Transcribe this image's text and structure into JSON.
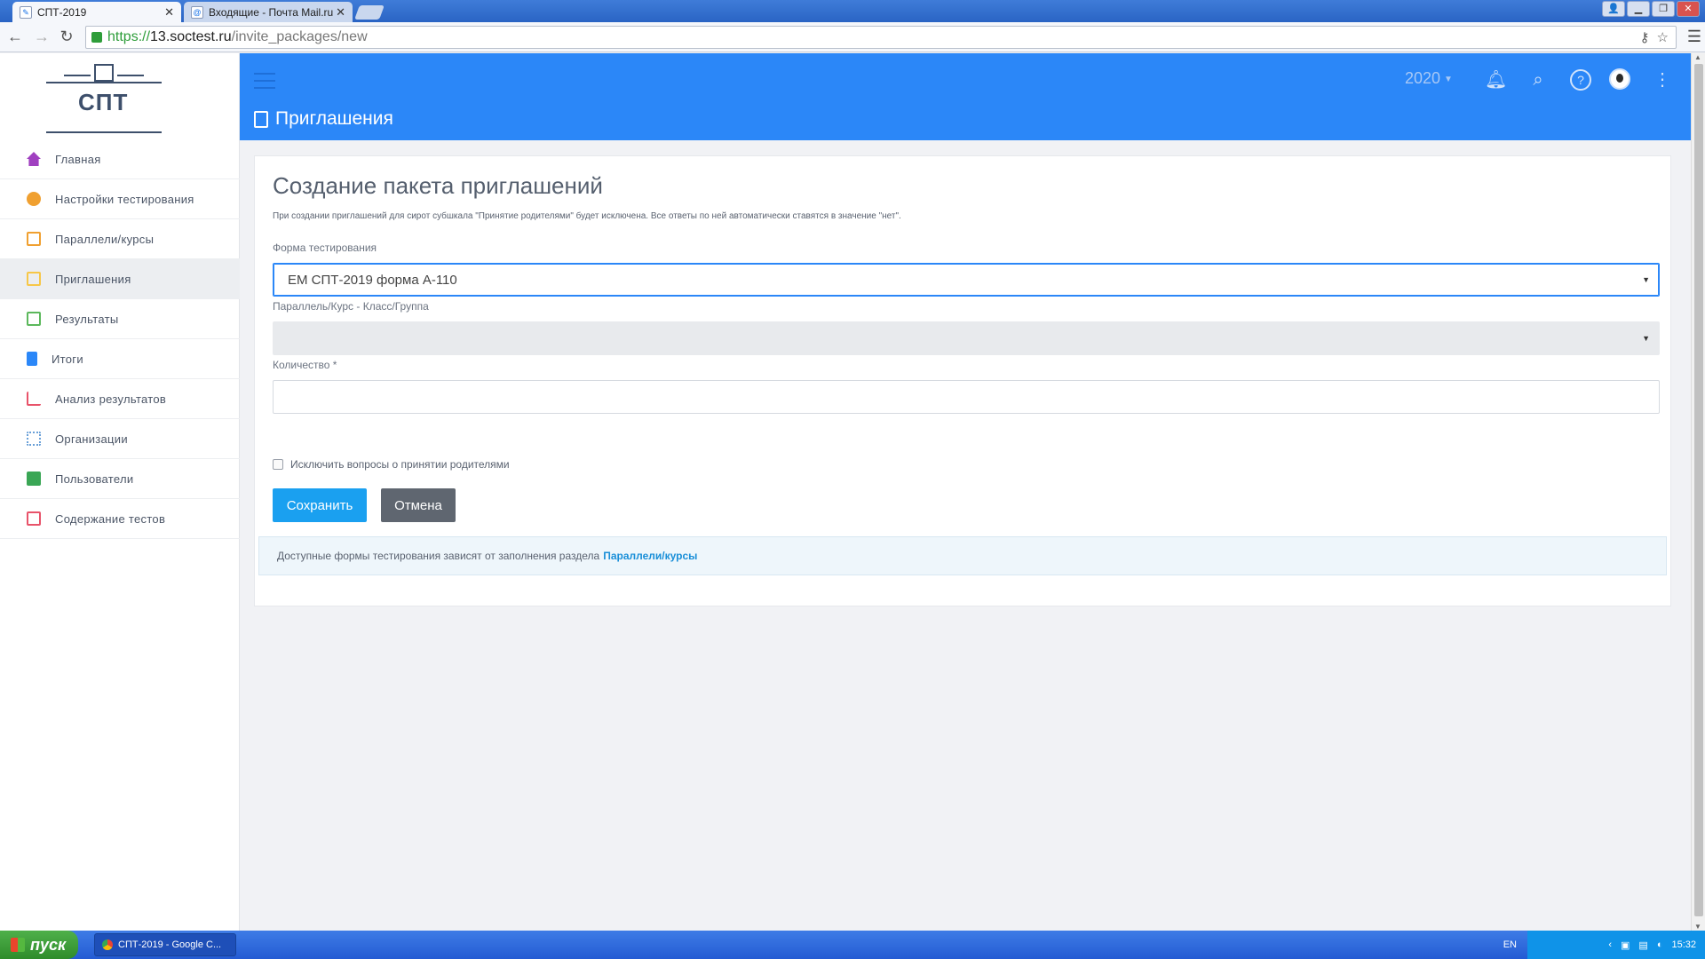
{
  "browser": {
    "tabs": [
      {
        "title": "СПТ-2019",
        "active": true
      },
      {
        "title": "Входящие - Почта Mail.ru",
        "active": false
      }
    ],
    "url": {
      "scheme": "https://",
      "host": "13.soctest.ru",
      "path": "/invite_packages/new"
    }
  },
  "sidebar": {
    "logo_text": "СПТ",
    "items": [
      {
        "label": "Главная",
        "icon": "home-icon",
        "color": "#a040c0"
      },
      {
        "label": "Настройки тестирования",
        "icon": "settings-icon",
        "color": "#f0a030"
      },
      {
        "label": "Параллели/курсы",
        "icon": "courses-icon",
        "color": "#f0a030"
      },
      {
        "label": "Приглашения",
        "icon": "invitation-icon",
        "color": "#f7c748"
      },
      {
        "label": "Результаты",
        "icon": "results-icon",
        "color": "#5cb85c"
      },
      {
        "label": "Итоги",
        "icon": "totals-icon",
        "color": "#2b87f8"
      },
      {
        "label": "Анализ результатов",
        "icon": "analysis-icon",
        "color": "#e8536a"
      },
      {
        "label": "Организации",
        "icon": "organizations-icon",
        "color": "#6aa0d8"
      },
      {
        "label": "Пользователи",
        "icon": "users-icon",
        "color": "#3aa655"
      },
      {
        "label": "Содержание тестов",
        "icon": "tests-content-icon",
        "color": "#e8536a"
      }
    ]
  },
  "header": {
    "year": "2020",
    "page_title": "Приглашения"
  },
  "form": {
    "title": "Создание пакета приглашений",
    "note": "При создании приглашений для сирот субшкала \"Принятие родителями\" будет исключена. Все ответы по ней автоматически ставятся в значение \"нет\".",
    "test_form_label": "Форма тестирования",
    "test_form_value": "ЕМ СПТ-2019 форма А-110",
    "group_label": "Параллель/Курс - Класс/Группа",
    "group_value": "",
    "quantity_label": "Количество *",
    "quantity_value": "",
    "exclude_label": "Исключить вопросы о принятии родителями",
    "save_label": "Сохранить",
    "cancel_label": "Отмена",
    "info_text": "Доступные формы тестирования зависят от заполнения раздела",
    "info_link": "Параллели/курсы"
  },
  "taskbar": {
    "start_label": "пуск",
    "task_label": "СПТ-2019 - Google C...",
    "lang": "EN",
    "clock": "15:32"
  }
}
